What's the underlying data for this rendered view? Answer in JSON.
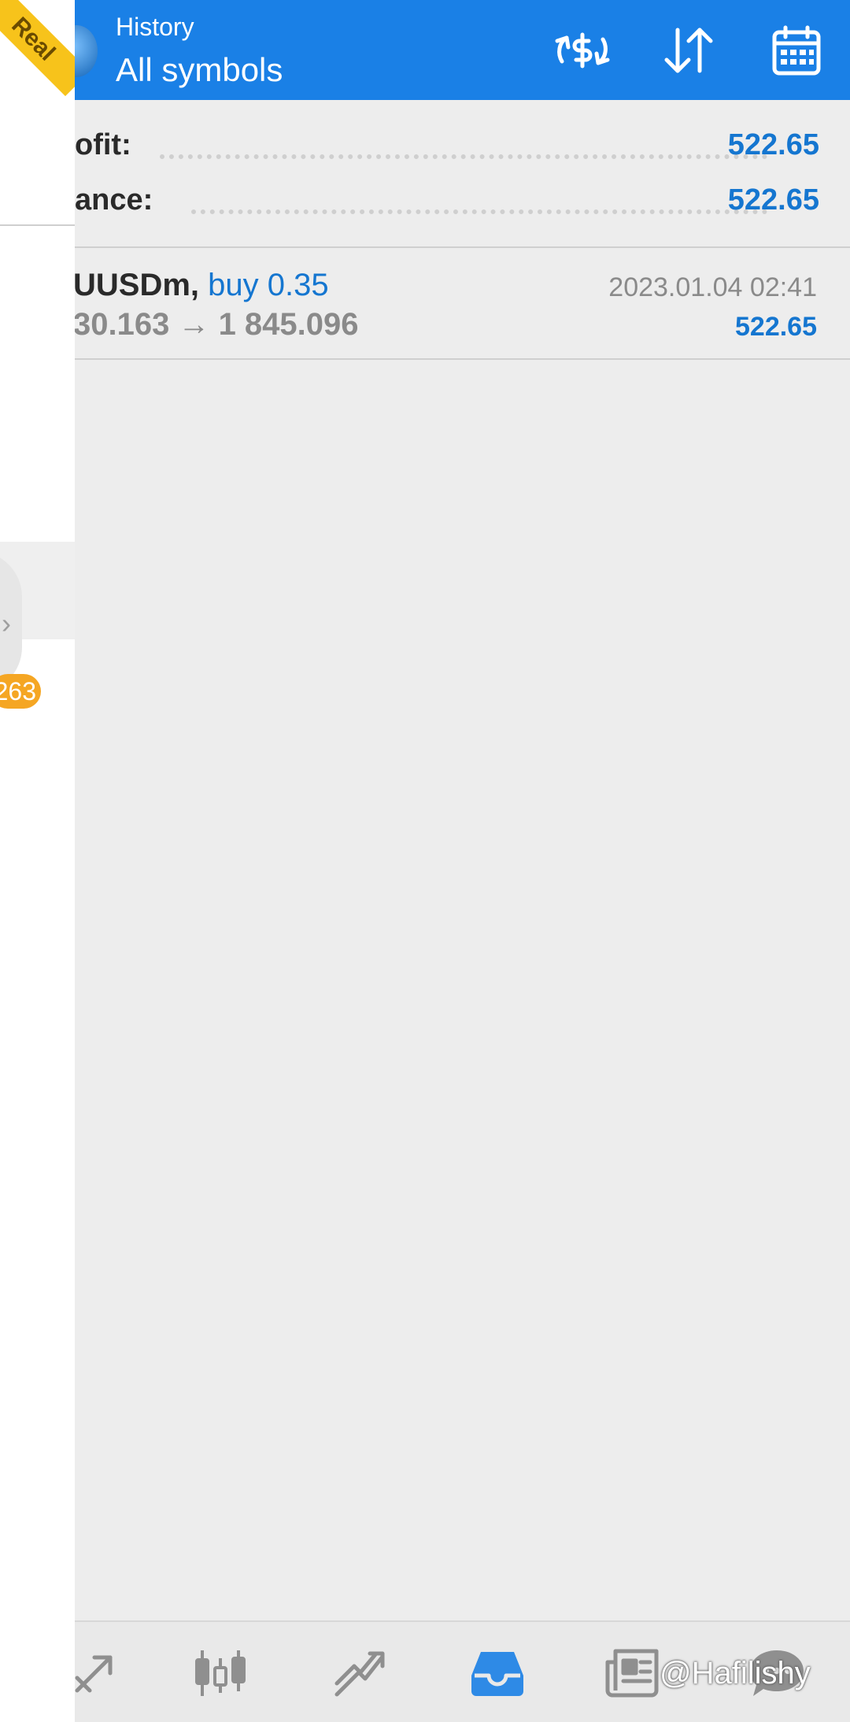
{
  "account_ribbon": "Real",
  "header": {
    "subtitle": "History",
    "title": "All symbols",
    "icons": [
      "currency-exchange-icon",
      "sort-icon",
      "calendar-icon"
    ]
  },
  "summary": {
    "profit_label": "ofit:",
    "profit_value": "522.65",
    "balance_label": "ance:",
    "balance_value": "522.65"
  },
  "deals": [
    {
      "symbol": "UUSDm,",
      "type": "buy 0.35",
      "prices": "30.163 → 1 845.096",
      "time": "2023.01.04 02:41",
      "profit": "522.65"
    }
  ],
  "drawer": {
    "badge": "263"
  },
  "bottom_nav": {
    "items": [
      "quotes-icon",
      "chart-icon",
      "trade-icon",
      "history-icon",
      "news-icon",
      "messages-icon"
    ],
    "active": "history-icon"
  },
  "watermark": "@Hafilishy",
  "colors": {
    "header": "#1a80e6",
    "accent": "#1576d0",
    "ribbon": "#f7c31b",
    "badge": "#f5a623",
    "background": "#ededed"
  }
}
